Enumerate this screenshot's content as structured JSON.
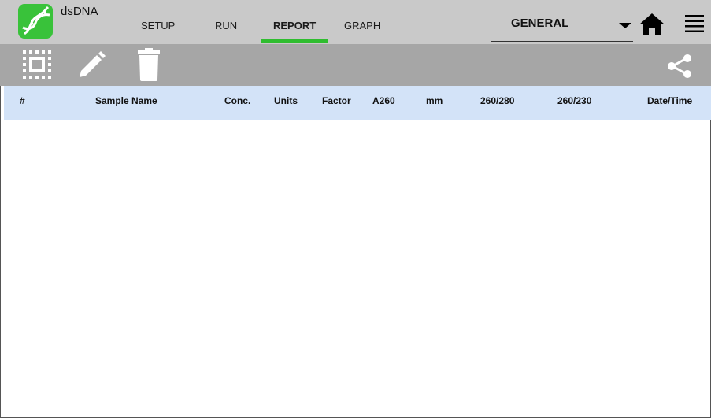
{
  "app": {
    "title": "dsDNA",
    "logo_icon": "dna-icon",
    "brand_color": "#39c23a"
  },
  "nav": {
    "tabs": [
      {
        "label": "SETUP",
        "active": false
      },
      {
        "label": "RUN",
        "active": false
      },
      {
        "label": "REPORT",
        "active": true
      },
      {
        "label": "GRAPH",
        "active": false
      }
    ],
    "active_indicator_color": "#2fbd2f"
  },
  "mode": {
    "selected": "GENERAL"
  },
  "header_actions": {
    "home_icon": "home-icon",
    "menu_icon": "menu-icon"
  },
  "toolbar": {
    "select_all_icon": "select-all-icon",
    "edit_icon": "pencil-icon",
    "delete_icon": "trash-icon",
    "share_icon": "share-icon"
  },
  "table": {
    "columns": [
      "#",
      "Sample Name",
      "Conc.",
      "Units",
      "Factor",
      "A260",
      "mm",
      "260/280",
      "260/230",
      "Date/Time"
    ],
    "rows": [],
    "header_color": "#d3e3f8"
  }
}
